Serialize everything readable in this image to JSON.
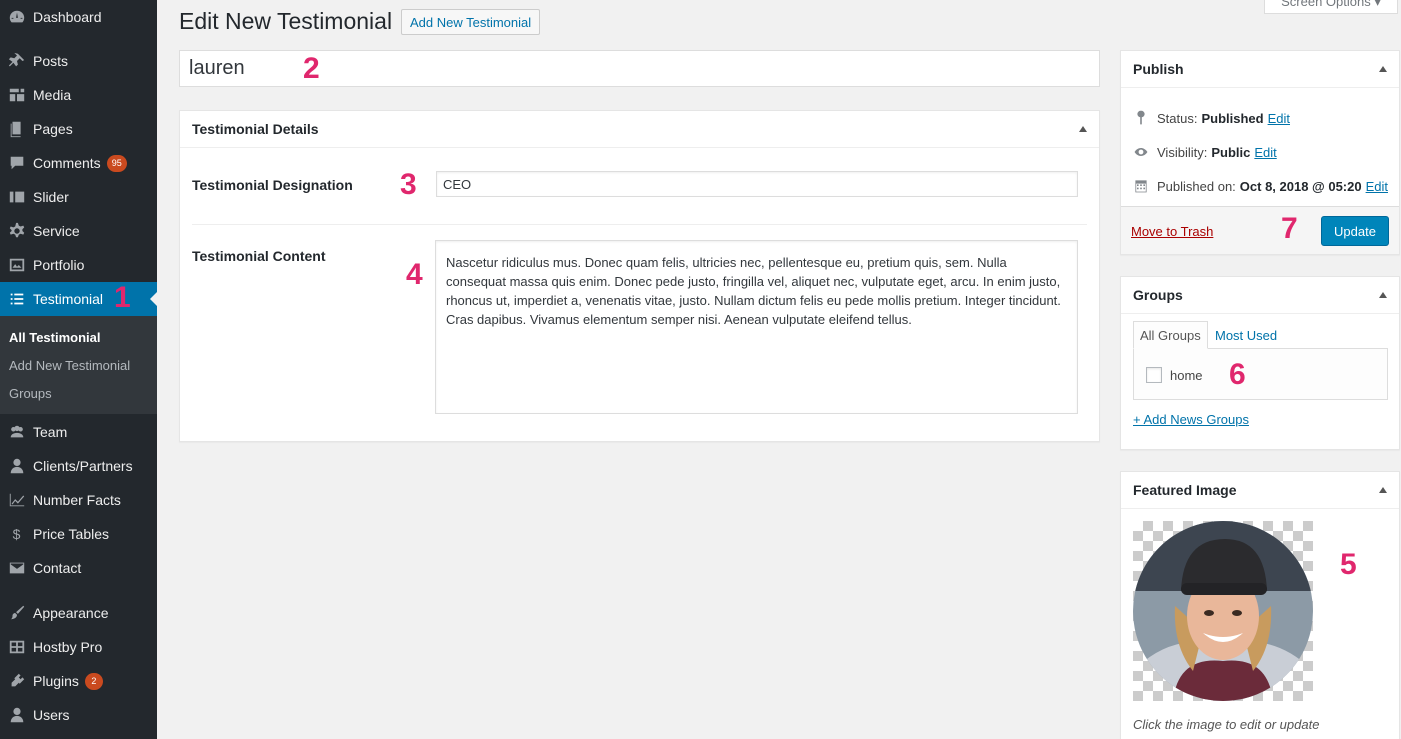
{
  "sidebar": {
    "items": [
      {
        "label": "Dashboard",
        "icon": "dashboard-icon"
      },
      {
        "label": "Posts",
        "icon": "pin-icon"
      },
      {
        "label": "Media",
        "icon": "media-icon"
      },
      {
        "label": "Pages",
        "icon": "pages-icon"
      },
      {
        "label": "Comments",
        "icon": "comments-icon",
        "badge": "95"
      },
      {
        "label": "Slider",
        "icon": "slider-icon"
      },
      {
        "label": "Service",
        "icon": "gear-icon"
      },
      {
        "label": "Portfolio",
        "icon": "portfolio-icon"
      },
      {
        "label": "Testimonial",
        "icon": "list-icon",
        "active": true
      },
      {
        "label": "Team",
        "icon": "team-icon"
      },
      {
        "label": "Clients/Partners",
        "icon": "user-icon"
      },
      {
        "label": "Number Facts",
        "icon": "chart-icon"
      },
      {
        "label": "Price Tables",
        "icon": "dollar-icon"
      },
      {
        "label": "Contact",
        "icon": "mail-icon"
      },
      {
        "label": "Appearance",
        "icon": "brush-icon"
      },
      {
        "label": "Hostby Pro",
        "icon": "grid-icon"
      },
      {
        "label": "Plugins",
        "icon": "plugin-icon",
        "badge": "2"
      },
      {
        "label": "Users",
        "icon": "user-icon"
      }
    ],
    "submenu": [
      "All Testimonial",
      "Add New Testimonial",
      "Groups"
    ]
  },
  "header": {
    "title": "Edit New Testimonial",
    "add_new_label": "Add New Testimonial",
    "screen_options": "Screen Options ▾"
  },
  "post_title": "lauren",
  "details": {
    "heading": "Testimonial Details",
    "designation_label": "Testimonial Designation",
    "designation_value": "CEO",
    "content_label": "Testimonial Content",
    "content_value": "Nascetur ridiculus mus. Donec quam felis, ultricies nec, pellentesque eu, pretium quis, sem. Nulla consequat massa quis enim. Donec pede justo, fringilla vel, aliquet nec, vulputate eget, arcu. In enim justo, rhoncus ut, imperdiet a, venenatis vitae, justo. Nullam dictum felis eu pede mollis pretium. Integer tincidunt. Cras dapibus. Vivamus elementum semper nisi. Aenean vulputate eleifend tellus."
  },
  "publish": {
    "heading": "Publish",
    "status_label": "Status:",
    "status_value": "Published",
    "visibility_label": "Visibility:",
    "visibility_value": "Public",
    "published_label": "Published on:",
    "published_value": "Oct 8, 2018 @ 05:20",
    "edit_label": "Edit",
    "trash_label": "Move to Trash",
    "update_label": "Update"
  },
  "groups": {
    "heading": "Groups",
    "tab_all": "All Groups",
    "tab_used": "Most Used",
    "items": [
      "home"
    ],
    "add_label": "+ Add News Groups"
  },
  "featured": {
    "heading": "Featured Image",
    "caption": "Click the image to edit or update"
  },
  "annotations": [
    "1",
    "2",
    "3",
    "4",
    "5",
    "6",
    "7"
  ],
  "colors": {
    "sidebar_bg": "#23282d",
    "active_bg": "#0073aa",
    "annotation": "#e0276d",
    "primary_button": "#0085ba"
  }
}
